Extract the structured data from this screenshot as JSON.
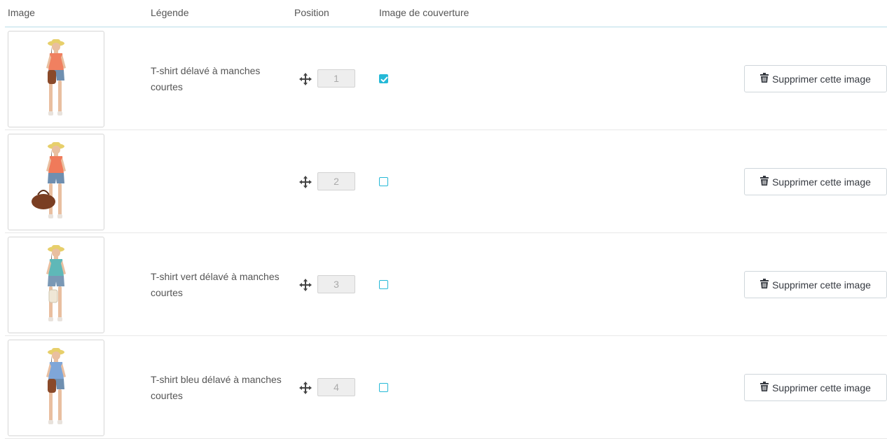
{
  "table": {
    "headers": {
      "image": "Image",
      "caption": "Légende",
      "position": "Position",
      "cover": "Image de couverture"
    },
    "rows": [
      {
        "caption": "T-shirt délavé à manches courtes",
        "position": "1",
        "cover": true,
        "delete_label": "Supprimer cette image",
        "top_color": "#f08060",
        "bottom_color": "#6f8fb0",
        "has_bag": "brown"
      },
      {
        "caption": "",
        "position": "2",
        "cover": false,
        "delete_label": "Supprimer cette image",
        "top_color": "#f07a5a",
        "bottom_color": "#6f8fb0",
        "has_bag": "brown-large"
      },
      {
        "caption": "T-shirt vert délavé à manches courtes",
        "position": "3",
        "cover": false,
        "delete_label": "Supprimer cette image",
        "top_color": "#5fb8b8",
        "bottom_color": "#7a98b5",
        "has_bag": "white"
      },
      {
        "caption": "T-shirt bleu délavé à manches courtes",
        "position": "4",
        "cover": false,
        "delete_label": "Supprimer cette image",
        "top_color": "#7fa6d8",
        "bottom_color": "#6f8fb0",
        "has_bag": "brown"
      }
    ]
  },
  "colors": {
    "accent": "#25b9d7",
    "header_line": "#b9dde8",
    "row_line": "#e8e8e8",
    "text": "#555555"
  },
  "icons": {
    "move": "move-arrows-icon",
    "trash": "trash-icon",
    "check": "check-icon"
  }
}
